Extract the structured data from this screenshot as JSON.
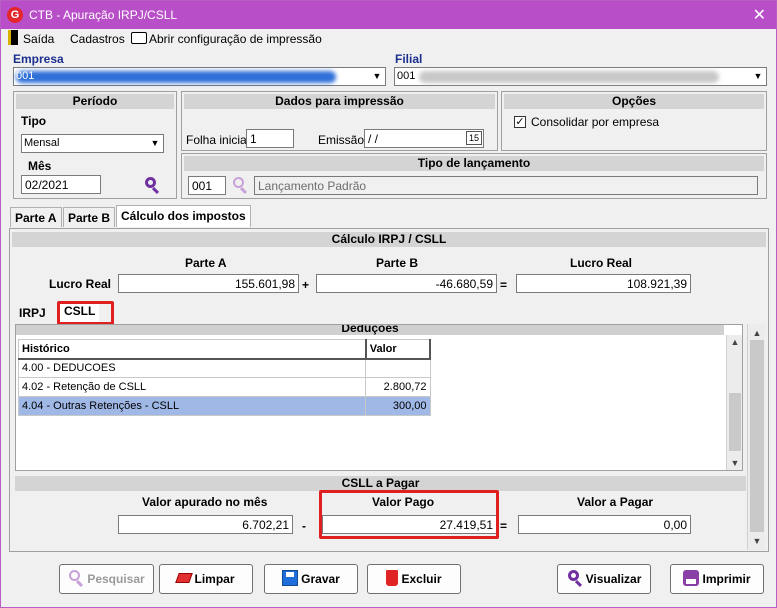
{
  "window": {
    "title": "CTB - Apuração IRPJ/CSLL",
    "app_icon_letter": "G"
  },
  "menu": {
    "exit_label": "Saída",
    "register_label": "Cadastros",
    "print_config_label": "Abrir configuração de impressão"
  },
  "company": {
    "label": "Empresa",
    "value": "001"
  },
  "branch": {
    "label": "Filial",
    "value": "001"
  },
  "period": {
    "header": "Período",
    "type_label": "Tipo",
    "type_value": "Mensal",
    "month_label": "Mês",
    "month_value": "02/2021"
  },
  "print_data": {
    "header": "Dados para impressão",
    "first_page_label": "Folha inicial",
    "first_page_value": "1",
    "issue_label": "Emissão",
    "issue_value": " / /",
    "calendar_glyph": "15"
  },
  "options": {
    "header": "Opções",
    "consolidate_label": "Consolidar por empresa",
    "consolidate_checked": "✓"
  },
  "entry_type": {
    "header": "Tipo de lançamento",
    "code": "001",
    "description": "Lançamento Padrão"
  },
  "tabs": [
    "Parte A",
    "Parte B",
    "Cálculo dos impostos"
  ],
  "calc": {
    "header": "Cálculo IRPJ / CSLL",
    "row_label": "Lucro Real",
    "col_a": "Parte A",
    "col_b": "Parte B",
    "col_result": "Lucro Real",
    "value_a": "155.601,98",
    "op_plus": "+",
    "value_b": "-46.680,59",
    "op_equals": "=",
    "value_result": "108.921,39"
  },
  "sub_tabs": [
    "IRPJ",
    "CSLL"
  ],
  "deductions": {
    "header": "Deduções",
    "col_history": "Histórico",
    "col_value": "Valor",
    "rows": [
      {
        "history": "4.00 - DEDUCOES",
        "value": ""
      },
      {
        "history": "4.02 - Retenção de CSLL",
        "value": "2.800,72"
      },
      {
        "history": "4.04 - Outras Retenções - CSLL",
        "value": "300,00"
      }
    ],
    "scroll_up": "▲",
    "scroll_down": "▼"
  },
  "payable": {
    "header": "CSLL a Pagar",
    "assessed_label": "Valor apurado no mês",
    "paid_label": "Valor Pago",
    "to_pay_label": "Valor a Pagar",
    "assessed_value": "6.702,21",
    "op_minus": "-",
    "paid_value": "27.419,51",
    "op_equals": "=",
    "to_pay_value": "0,00"
  },
  "buttons": {
    "search": "Pesquisar",
    "clear": "Limpar",
    "save": "Gravar",
    "delete": "Excluir",
    "view": "Visualizar",
    "print": "Imprimir"
  },
  "colors": {
    "titlebar": "#b94fc8",
    "highlight_box": "#e02020",
    "selection": "#9fb8e6",
    "label_blue": "#1b2f8e"
  }
}
